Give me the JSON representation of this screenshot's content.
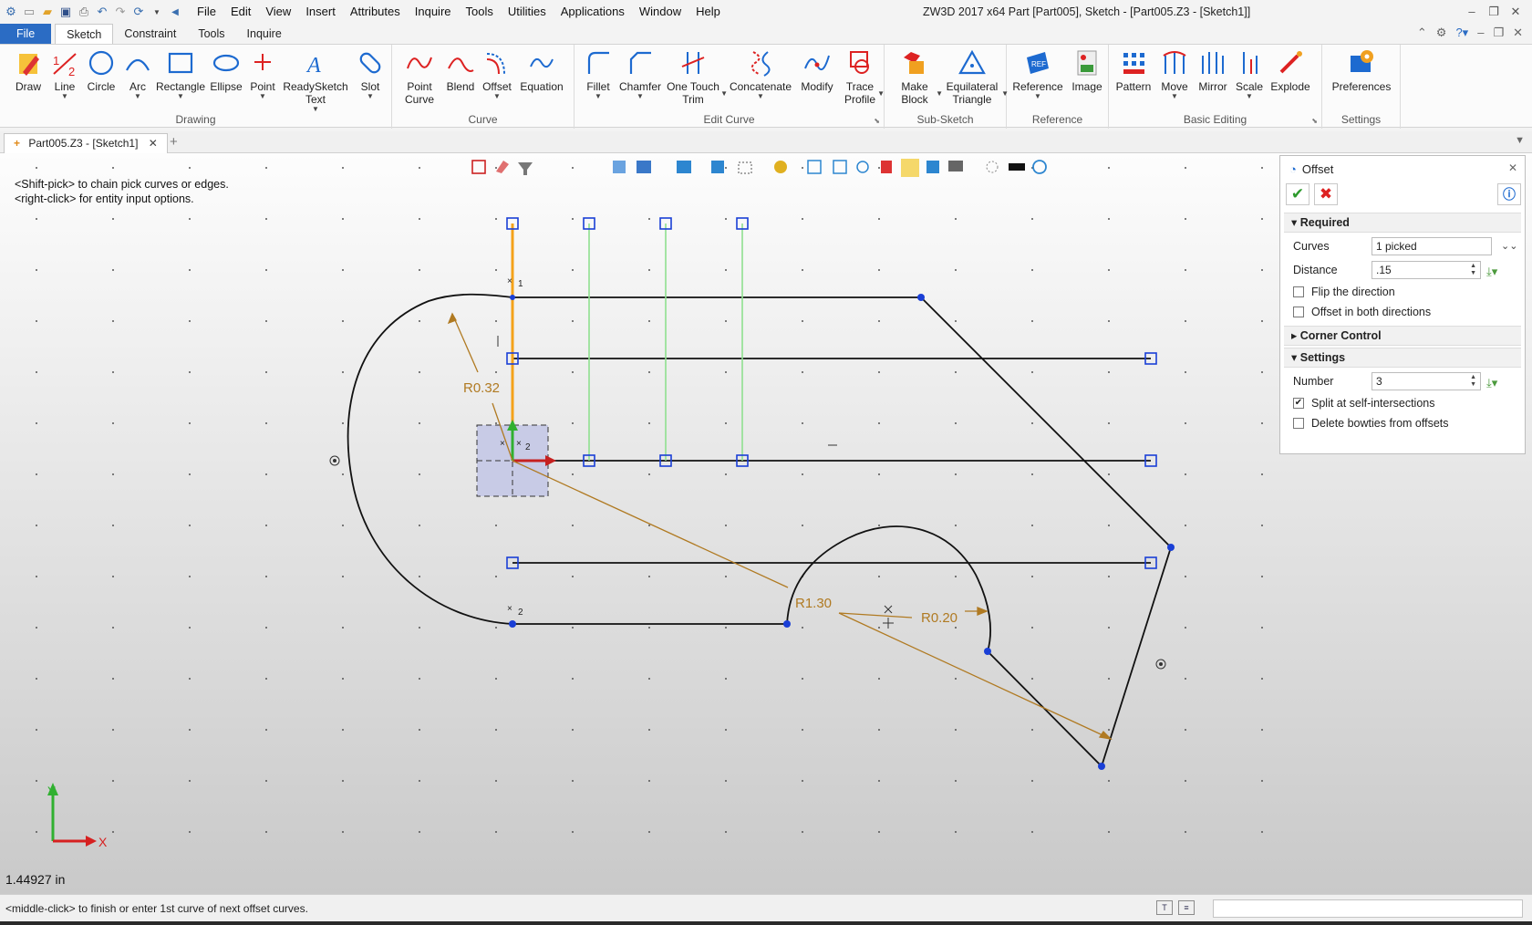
{
  "app": {
    "title": "ZW3D 2017  x64     Part [Part005], Sketch - [Part005.Z3 - [Sketch1]]"
  },
  "menu": [
    "File",
    "Edit",
    "View",
    "Insert",
    "Attributes",
    "Inquire",
    "Tools",
    "Utilities",
    "Applications",
    "Window",
    "Help"
  ],
  "ribbon_tabs": [
    "File",
    "Sketch",
    "Constraint",
    "Tools",
    "Inquire"
  ],
  "ribbon": {
    "drawing": {
      "label": "Drawing",
      "buttons": [
        "Draw",
        "Line",
        "Circle",
        "Arc",
        "Rectangle",
        "Ellipse",
        "Point",
        "ReadySketch Text",
        "Slot"
      ]
    },
    "curve": {
      "label": "Curve",
      "buttons": [
        "Point Curve",
        "Blend",
        "Offset",
        "Equation"
      ]
    },
    "edit_curve": {
      "label": "Edit Curve",
      "buttons": [
        "Fillet",
        "Chamfer",
        "One Touch Trim",
        "Concatenate",
        "Modify",
        "Trace Profile"
      ]
    },
    "sub_sketch": {
      "label": "Sub-Sketch",
      "buttons": [
        "Make Block",
        "Equilateral Triangle"
      ]
    },
    "reference": {
      "label": "Reference",
      "buttons": [
        "Reference",
        "Image"
      ]
    },
    "basic_editing": {
      "label": "Basic Editing",
      "buttons": [
        "Pattern",
        "Move",
        "Mirror",
        "Scale",
        "Explode"
      ]
    },
    "settings": {
      "label": "Settings",
      "buttons": [
        "Preferences"
      ]
    }
  },
  "doc_tab": "Part005.Z3 - [Sketch1]",
  "hint": {
    "line1": "<Shift-pick> to chain pick curves or edges.",
    "line2": "<right-click> for entity input options."
  },
  "dimensions": {
    "r1": "R0.32",
    "r2": "R1.30",
    "r3": "R0.20"
  },
  "constraint_labels": {
    "c1": "1",
    "c2": "2",
    "c3": "2"
  },
  "axes": {
    "x": "X",
    "y": "Y"
  },
  "readout": "1.44927 in",
  "offset_panel": {
    "title": "Offset",
    "required_label": "Required",
    "curves_label": "Curves",
    "curves_value": "1 picked",
    "distance_label": "Distance",
    "distance_value": ".15",
    "flip_label": "Flip the direction",
    "both_label": "Offset in both directions",
    "corner_label": "Corner Control",
    "settings_label": "Settings",
    "number_label": "Number",
    "number_value": "3",
    "split_label": "Split at self-intersections",
    "split_checked": true,
    "bowties_label": "Delete bowties from offsets"
  },
  "status": {
    "text": "<middle-click> to finish or enter 1st curve of next offset curves."
  },
  "colors": {
    "accent": "#2b6cc4",
    "selected_curve": "#f4a21a",
    "dimension": "#b07a22",
    "offset_preview": "#8fe08f",
    "handle": "#1a3fd6"
  }
}
